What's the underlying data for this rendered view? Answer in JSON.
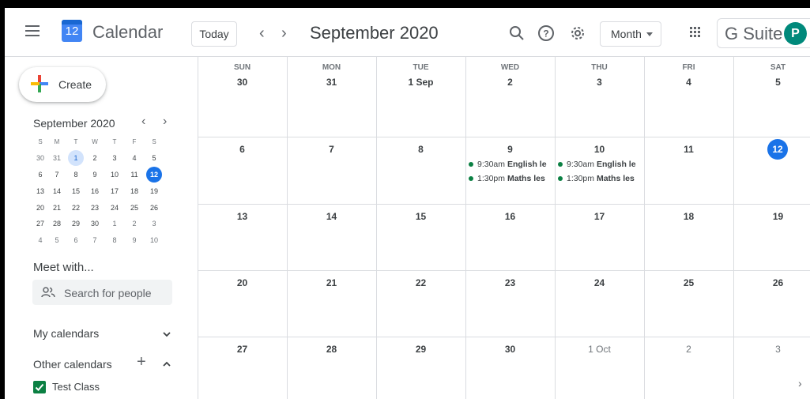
{
  "header": {
    "app_name": "Calendar",
    "logo_day": "12",
    "today_label": "Today",
    "prev": "‹",
    "next": "›",
    "current_period": "September 2020",
    "view_label": "Month",
    "brand_label": "G Suite",
    "avatar_initial": "P",
    "icons": [
      "menu-icon",
      "search-icon",
      "help-icon",
      "settings-icon",
      "apps-icon"
    ]
  },
  "sidebar": {
    "create_label": "Create",
    "mini_calendar": {
      "title": "September 2020",
      "prev": "‹",
      "next": "›",
      "weekdays": [
        "S",
        "M",
        "T",
        "W",
        "T",
        "F",
        "S"
      ],
      "weeks": [
        [
          "30",
          "31",
          "1",
          "2",
          "3",
          "4",
          "5"
        ],
        [
          "6",
          "7",
          "8",
          "9",
          "10",
          "11",
          "12"
        ],
        [
          "13",
          "14",
          "15",
          "16",
          "17",
          "18",
          "19"
        ],
        [
          "20",
          "21",
          "22",
          "23",
          "24",
          "25",
          "26"
        ],
        [
          "27",
          "28",
          "29",
          "30",
          "1",
          "2",
          "3"
        ],
        [
          "4",
          "5",
          "6",
          "7",
          "8",
          "9",
          "10"
        ]
      ]
    },
    "meet_title": "Meet with...",
    "search_people_placeholder": "Search for people",
    "my_calendars_label": "My calendars",
    "other_calendars_label": "Other calendars",
    "other_calendars": [
      {
        "name": "Test Class",
        "color": "#0b8043"
      }
    ]
  },
  "grid": {
    "weekdays": [
      "SUN",
      "MON",
      "TUE",
      "WED",
      "THU",
      "FRI",
      "SAT"
    ],
    "weeks": [
      [
        "30",
        "31",
        "1 Sep",
        "2",
        "3",
        "4",
        "5"
      ],
      [
        "6",
        "7",
        "8",
        "9",
        "10",
        "11",
        "12"
      ],
      [
        "13",
        "14",
        "15",
        "16",
        "17",
        "18",
        "19"
      ],
      [
        "20",
        "21",
        "22",
        "23",
        "24",
        "25",
        "26"
      ],
      [
        "27",
        "28",
        "29",
        "30",
        "1 Oct",
        "2",
        "3"
      ]
    ],
    "events": {
      "wed9_1_time": "9:30am",
      "wed9_1_title": "English le",
      "wed9_2_time": "1:30pm",
      "wed9_2_title": "Maths les",
      "thu10_1_time": "9:30am",
      "thu10_1_title": "English le",
      "thu10_2_time": "1:30pm",
      "thu10_2_title": "Maths les"
    },
    "scroll_right": "›"
  },
  "colors": {
    "accent": "#1a73e8",
    "event_dot": "#0b8043",
    "avatar": "#00897b"
  }
}
